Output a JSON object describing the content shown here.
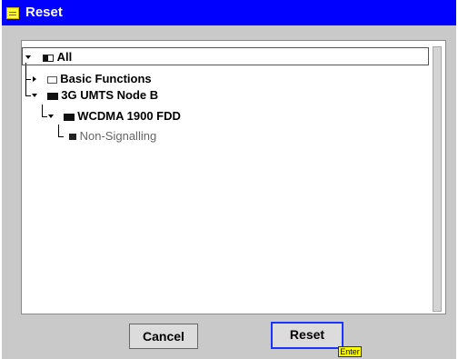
{
  "dialog": {
    "title": "Reset"
  },
  "tree": {
    "items": [
      {
        "label": "All",
        "state": "expanded",
        "check": "partial"
      },
      {
        "label": "Basic Functions",
        "state": "collapsed",
        "check": "unchecked"
      },
      {
        "label": "3G UMTS Node B",
        "state": "expanded",
        "check": "checked"
      },
      {
        "label": "WCDMA 1900 FDD",
        "state": "expanded",
        "check": "checked"
      },
      {
        "label": "Non-Signalling",
        "state": "leaf",
        "check": "checked"
      }
    ]
  },
  "buttons": {
    "cancel_label": "Cancel",
    "reset_label": "Reset",
    "reset_hint": "Enter"
  },
  "colors": {
    "titlebar": "#0000ff",
    "dialog_bg": "#c9c9c9",
    "focus_border": "#1a33ff",
    "hint_bg": "#ffff00"
  }
}
